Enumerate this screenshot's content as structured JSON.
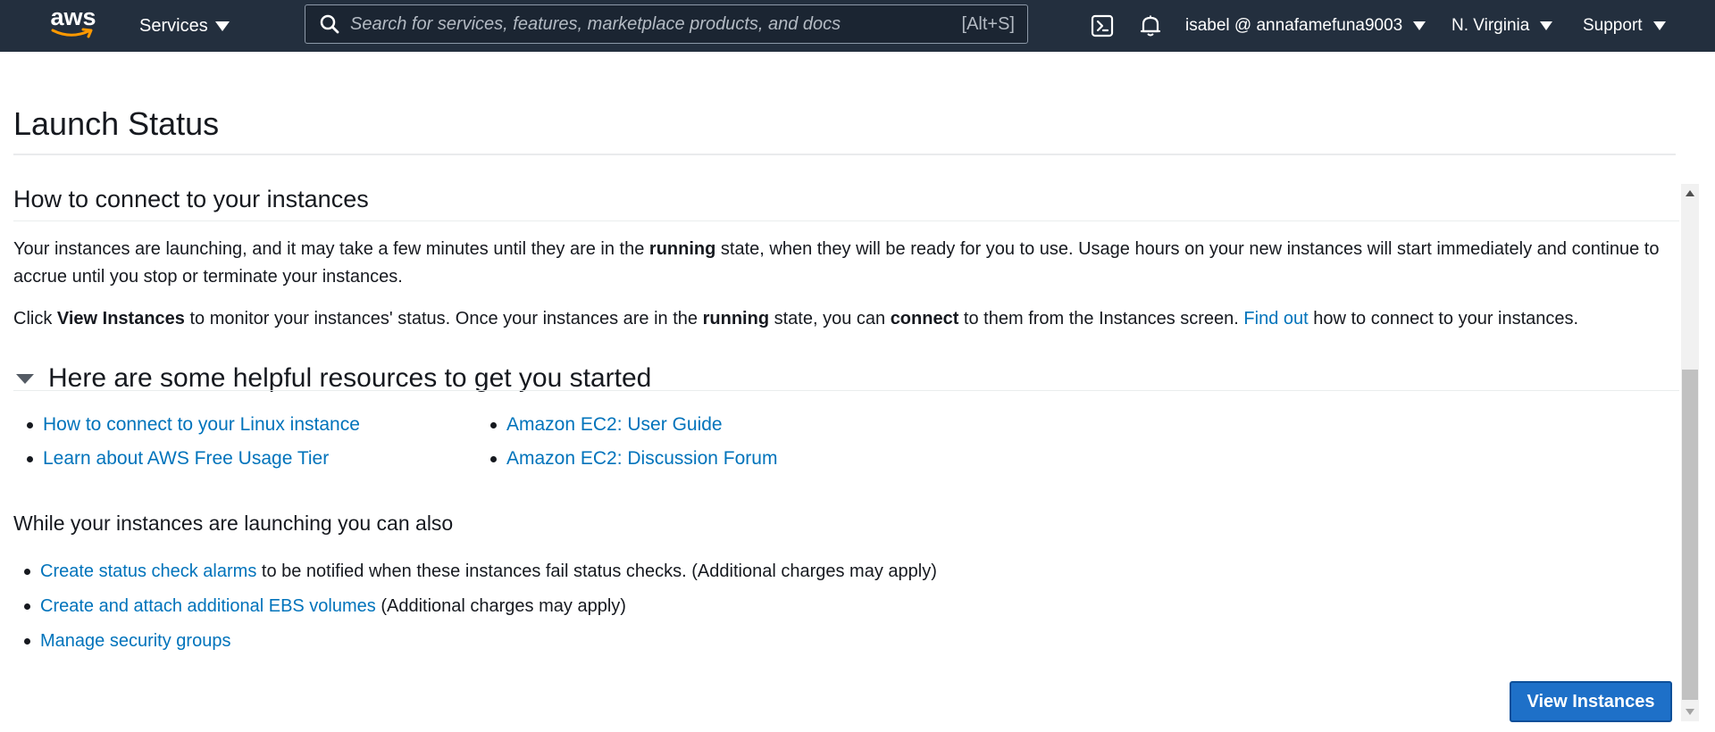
{
  "topnav": {
    "logo_text": "aws",
    "services_label": "Services",
    "search_placeholder": "Search for services, features, marketplace products, and docs",
    "search_shortcut": "[Alt+S]",
    "account_label": "isabel @ annafamefuna9003",
    "region_label": "N. Virginia",
    "support_label": "Support",
    "icons": [
      "search-icon",
      "cloudshell-icon",
      "bell-icon"
    ],
    "colors": {
      "background": "#232f3e",
      "logo_smile": "#ff9900"
    }
  },
  "page": {
    "title": "Launch Status",
    "connect_section": {
      "heading": "How to connect to your instances",
      "para1": {
        "t1": "Your instances are launching, and it may take a few minutes until they are in the ",
        "b1": "running",
        "t2": " state, when they will be ready for you to use. Usage hours on your new instances will start immediately and continue to accrue until you stop or terminate your instances."
      },
      "para2": {
        "t1": "Click ",
        "b1": "View Instances",
        "t2": " to monitor your instances' status. Once your instances are in the ",
        "b2": "running",
        "t3": " state, you can ",
        "b3": "connect",
        "t4": " to them from the Instances screen. ",
        "link": "Find out",
        "t5": " how to connect to your instances."
      }
    },
    "resources": {
      "heading": "Here are some helpful resources to get you started",
      "col1": [
        "How to connect to your Linux instance",
        "Learn about AWS Free Usage Tier"
      ],
      "col2": [
        "Amazon EC2: User Guide",
        "Amazon EC2: Discussion Forum"
      ]
    },
    "also": {
      "heading": "While your instances are launching you can also",
      "items": [
        {
          "link": "Create status check alarms",
          "text": " to be notified when these instances fail status checks. (Additional charges may apply)"
        },
        {
          "link": "Create and attach additional EBS volumes",
          "text": " (Additional charges may apply)"
        },
        {
          "link": "Manage security groups",
          "text": ""
        }
      ]
    },
    "view_instances_label": "View Instances",
    "colors": {
      "link": "#0073bb",
      "primary_button": "#1e70c8"
    }
  }
}
